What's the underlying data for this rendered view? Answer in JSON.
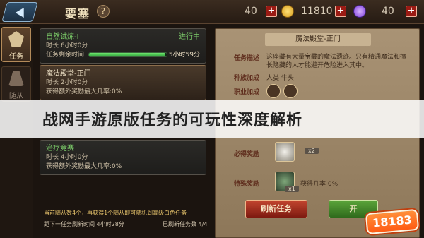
{
  "topbar": {
    "title": "要塞",
    "help": "?",
    "res1_value": "40",
    "res2_value": "11810",
    "res3_value": "40",
    "plus": "+",
    "coin_color": "#f2c13a",
    "gem_color": "#9b5df2"
  },
  "tabs": [
    {
      "label": "任务"
    },
    {
      "label": "随从"
    }
  ],
  "missions": [
    {
      "name": "自然试炼-I",
      "status": "进行中",
      "time": "时长 6小时0分",
      "remain_label": "任务剩余时间",
      "remain": "5小时59分",
      "progress": 0.98
    },
    {
      "name": "魔法殿堂-正门",
      "time": "时长 2小时0分",
      "bonus": "获得额外奖励最大几率:0%"
    },
    {
      "name": "治疗竞赛",
      "time": "时长 4小时0分",
      "bonus": "获得额外奖励最大几率:0%"
    }
  ],
  "list_footer": {
    "line1": "当前随从数4个，再获得1个随从即可随机到高级白色任务",
    "line2": "距下一任务刷新时间 4小时28分",
    "count": "已刷新任务数 4/4"
  },
  "detail": {
    "title": "魔法殿堂-正门",
    "desc_key": "任务描述",
    "desc": "这座藏有大量宝藏的魔法遗迹。只有精通魔法和擅长隐藏的人才能避开危险进入其中。",
    "race_key": "种族加成",
    "race": "人类 牛头",
    "job_key": "职业加成",
    "must_key": "必得奖励",
    "must_qty": "x2",
    "special_key": "特殊奖励",
    "special_qty": "x1",
    "special_rate": "获得几率 0%",
    "refresh_button": "刷新任务",
    "go_button": "开"
  },
  "banner": "战网手游原版任务的可玩性深度解析",
  "watermark": "18183"
}
